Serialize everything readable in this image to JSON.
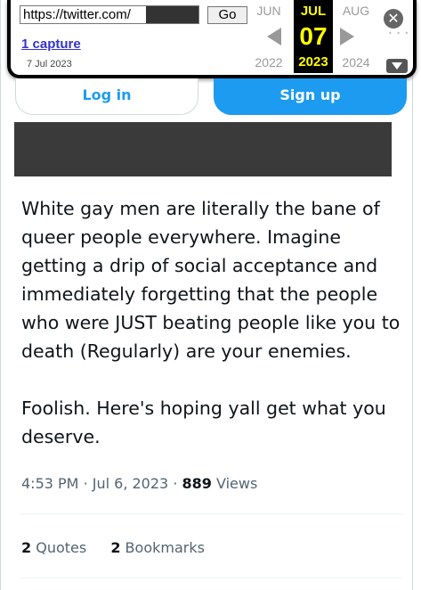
{
  "wayback": {
    "url": "https://twitter.com/",
    "go_label": "Go",
    "captures_label": "1 capture",
    "capture_date": "7 Jul 2023",
    "months": {
      "prev": "JUN",
      "current": "JUL",
      "next": "AUG"
    },
    "current_day": "07",
    "years": {
      "prev": "2022",
      "current": "2023",
      "next": "2024"
    },
    "close_glyph": "✕",
    "icons": [
      "close-icon",
      "prev-arrow-icon",
      "next-arrow-icon",
      "expand-icon"
    ]
  },
  "auth": {
    "login_label": "Log in",
    "signup_label": "Sign up",
    "signup_color": "#1d9bf0"
  },
  "tweet": {
    "paragraphs": [
      "White gay men are literally the bane of queer people everywhere. Imagine getting a drip of social acceptance and immediately forgetting that the people who were JUST beating people like you to death (Regularly) are your enemies.",
      "Foolish. Here's hoping yall get what you deserve."
    ],
    "time": "4:53 PM",
    "date": "Jul 6, 2023",
    "separator": "·",
    "views_count": "889",
    "views_label": "Views",
    "quotes_count": "2",
    "quotes_label": "Quotes",
    "bookmarks_count": "2",
    "bookmarks_label": "Bookmarks"
  }
}
